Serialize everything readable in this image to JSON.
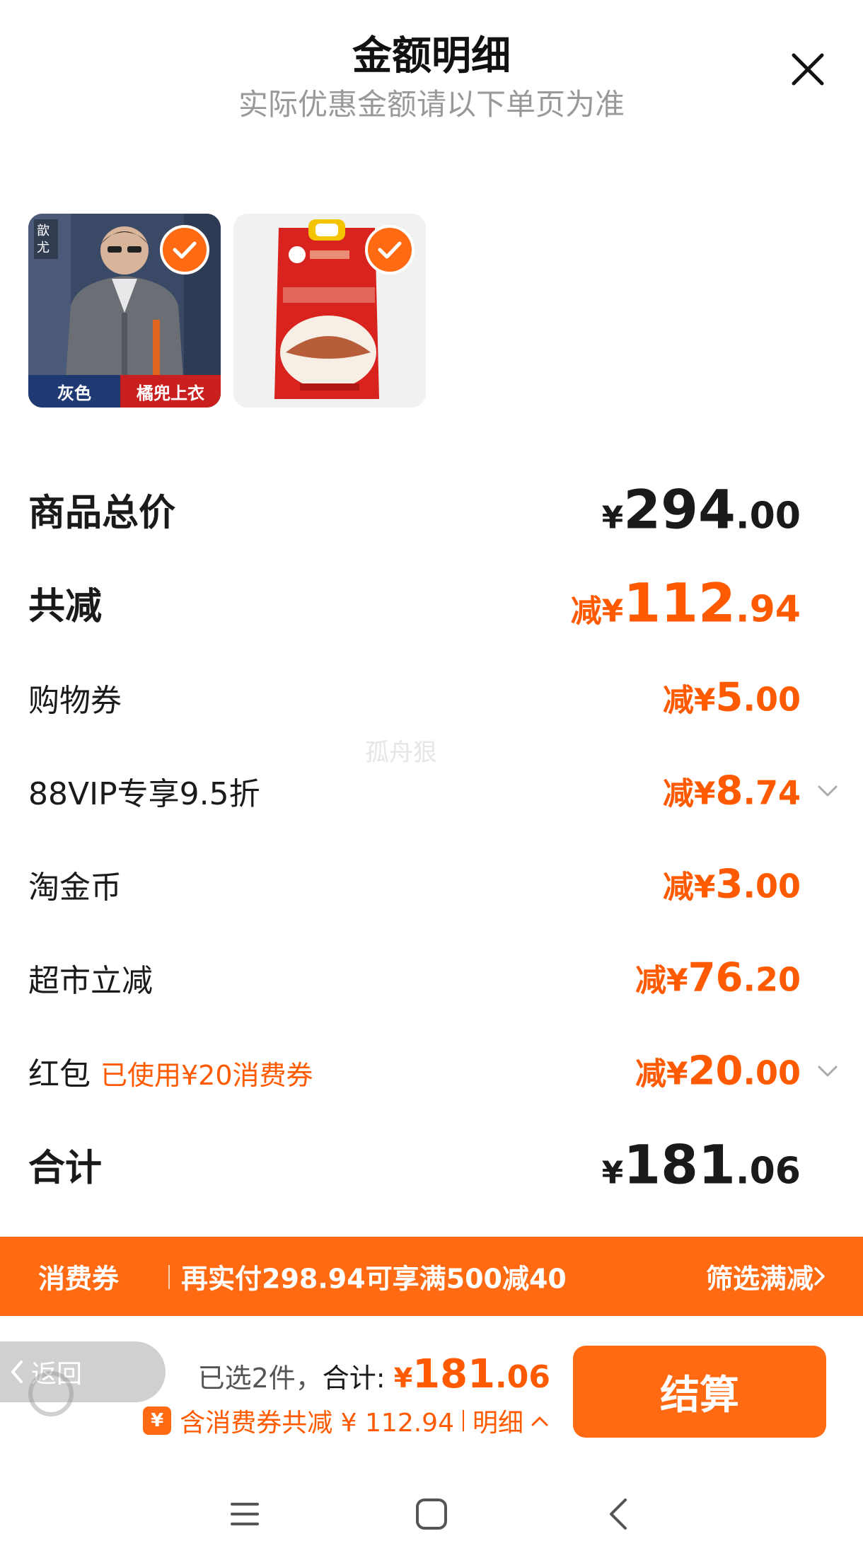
{
  "header": {
    "title": "金额明细",
    "subtitle": "实际优惠金额请以下单页为准"
  },
  "products": [
    {
      "name": "work-jacket",
      "caption_left": "灰色",
      "caption_right": "橘兜上衣",
      "selected": true
    },
    {
      "name": "rice-bag",
      "selected": true
    }
  ],
  "rows": {
    "subtotal": {
      "label": "商品总价",
      "sym": "¥",
      "int": "294",
      "dec": ".00"
    },
    "total_discount": {
      "label": "共减",
      "sym": "减¥",
      "int": "112",
      "dec": ".94"
    },
    "coupon": {
      "label": "购物券",
      "sym": "减¥",
      "int": "5",
      "dec": ".00"
    },
    "vip": {
      "label": "88VIP专享9.5折",
      "sym": "减¥",
      "int": "8",
      "dec": ".74"
    },
    "coins": {
      "label": "淘金币",
      "sym": "减¥",
      "int": "3",
      "dec": ".00"
    },
    "market": {
      "label": "超市立减",
      "sym": "减¥",
      "int": "76",
      "dec": ".20"
    },
    "redpacket": {
      "label": "红包",
      "note": "已使用¥20消费券",
      "sym": "减¥",
      "int": "20",
      "dec": ".00"
    },
    "grand_total": {
      "label": "合计",
      "sym": "¥",
      "int": "181",
      "dec": ".06"
    }
  },
  "watermark": "孤舟狠",
  "promo": {
    "tag": "消费券",
    "text": "再实付298.94可享满500减40",
    "link": "筛选满减"
  },
  "checkout": {
    "back_label": "返回",
    "selected_text": "已选2件，",
    "total_label": "合计:",
    "total_sym": "¥",
    "total_int": "181",
    "total_dec": ".06",
    "yen_icon": "¥",
    "discount_text": "含消费券共减 ¥ 112.94",
    "detail_link": "明细",
    "button_label": "结算"
  },
  "colors": {
    "accent": "#ff6a12",
    "discount_text": "#ff5a00"
  }
}
